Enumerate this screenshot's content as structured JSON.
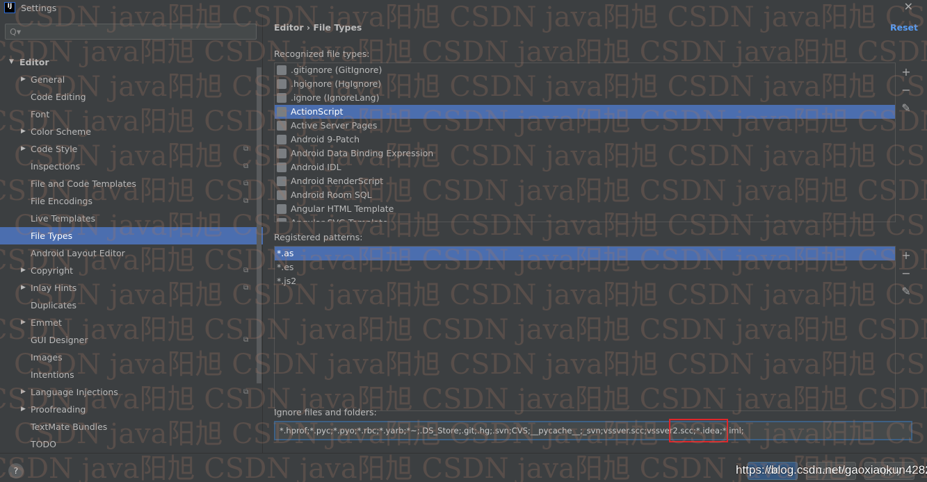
{
  "window": {
    "title": "Settings"
  },
  "search": {
    "placeholder": "Q▾"
  },
  "tree": [
    {
      "label": "Editor",
      "level": 0,
      "expanded": true
    },
    {
      "label": "General",
      "arrow": true
    },
    {
      "label": "Code Editing"
    },
    {
      "label": "Font"
    },
    {
      "label": "Color Scheme",
      "arrow": true
    },
    {
      "label": "Code Style",
      "arrow": true,
      "copy": true
    },
    {
      "label": "Inspections",
      "copy": true
    },
    {
      "label": "File and Code Templates",
      "copy": true
    },
    {
      "label": "File Encodings",
      "copy": true
    },
    {
      "label": "Live Templates"
    },
    {
      "label": "File Types",
      "selected": true
    },
    {
      "label": "Android Layout Editor"
    },
    {
      "label": "Copyright",
      "arrow": true,
      "copy": true
    },
    {
      "label": "Inlay Hints",
      "arrow": true,
      "copy": true
    },
    {
      "label": "Duplicates"
    },
    {
      "label": "Emmet",
      "arrow": true
    },
    {
      "label": "GUI Designer",
      "copy": true
    },
    {
      "label": "Images"
    },
    {
      "label": "Intentions"
    },
    {
      "label": "Language Injections",
      "arrow": true,
      "copy": true
    },
    {
      "label": "Proofreading",
      "arrow": true
    },
    {
      "label": "TextMate Bundles"
    },
    {
      "label": "TODO"
    }
  ],
  "breadcrumb": {
    "parent": "Editor",
    "sep": "›",
    "current": "File Types"
  },
  "reset": "Reset",
  "recognized": {
    "label": "Recognized file types:",
    "items": [
      ".gitignore (GitIgnore)",
      ".hgignore (HgIgnore)",
      ".ignore (IgnoreLang)",
      "ActionScript",
      "Active Server Pages",
      "Android 9-Patch",
      "Android Data Binding Expression",
      "Android IDL",
      "Android RenderScript",
      "Android Room SQL",
      "Angular HTML Template",
      "Angular SVG Template"
    ],
    "selected": 3
  },
  "patterns": {
    "label": "Registered patterns:",
    "items": [
      "*.as",
      "*.es",
      "*.js2"
    ],
    "selected": 0
  },
  "ignore": {
    "label": "Ignore files and folders:",
    "value": "*.hprof;*.pyc;*.pyo;*.rbc;*.yarb;*~;.DS_Store;.git;.hg;.svn;CVS;__pycache__;_svn;vssver.scc;vssver2.scc;*.idea;*.iml;"
  },
  "buttons": {
    "ok": "OK",
    "cancel": "Cancel",
    "apply": "Apply",
    "help": "?"
  },
  "watermark": "CSDN java阳旭",
  "source_url": "https://blog.csdn.net/gaoxiaokun4282",
  "colors": {
    "selection": "#4b6eaf",
    "highlight": "#e0262b",
    "link": "#589df6"
  }
}
